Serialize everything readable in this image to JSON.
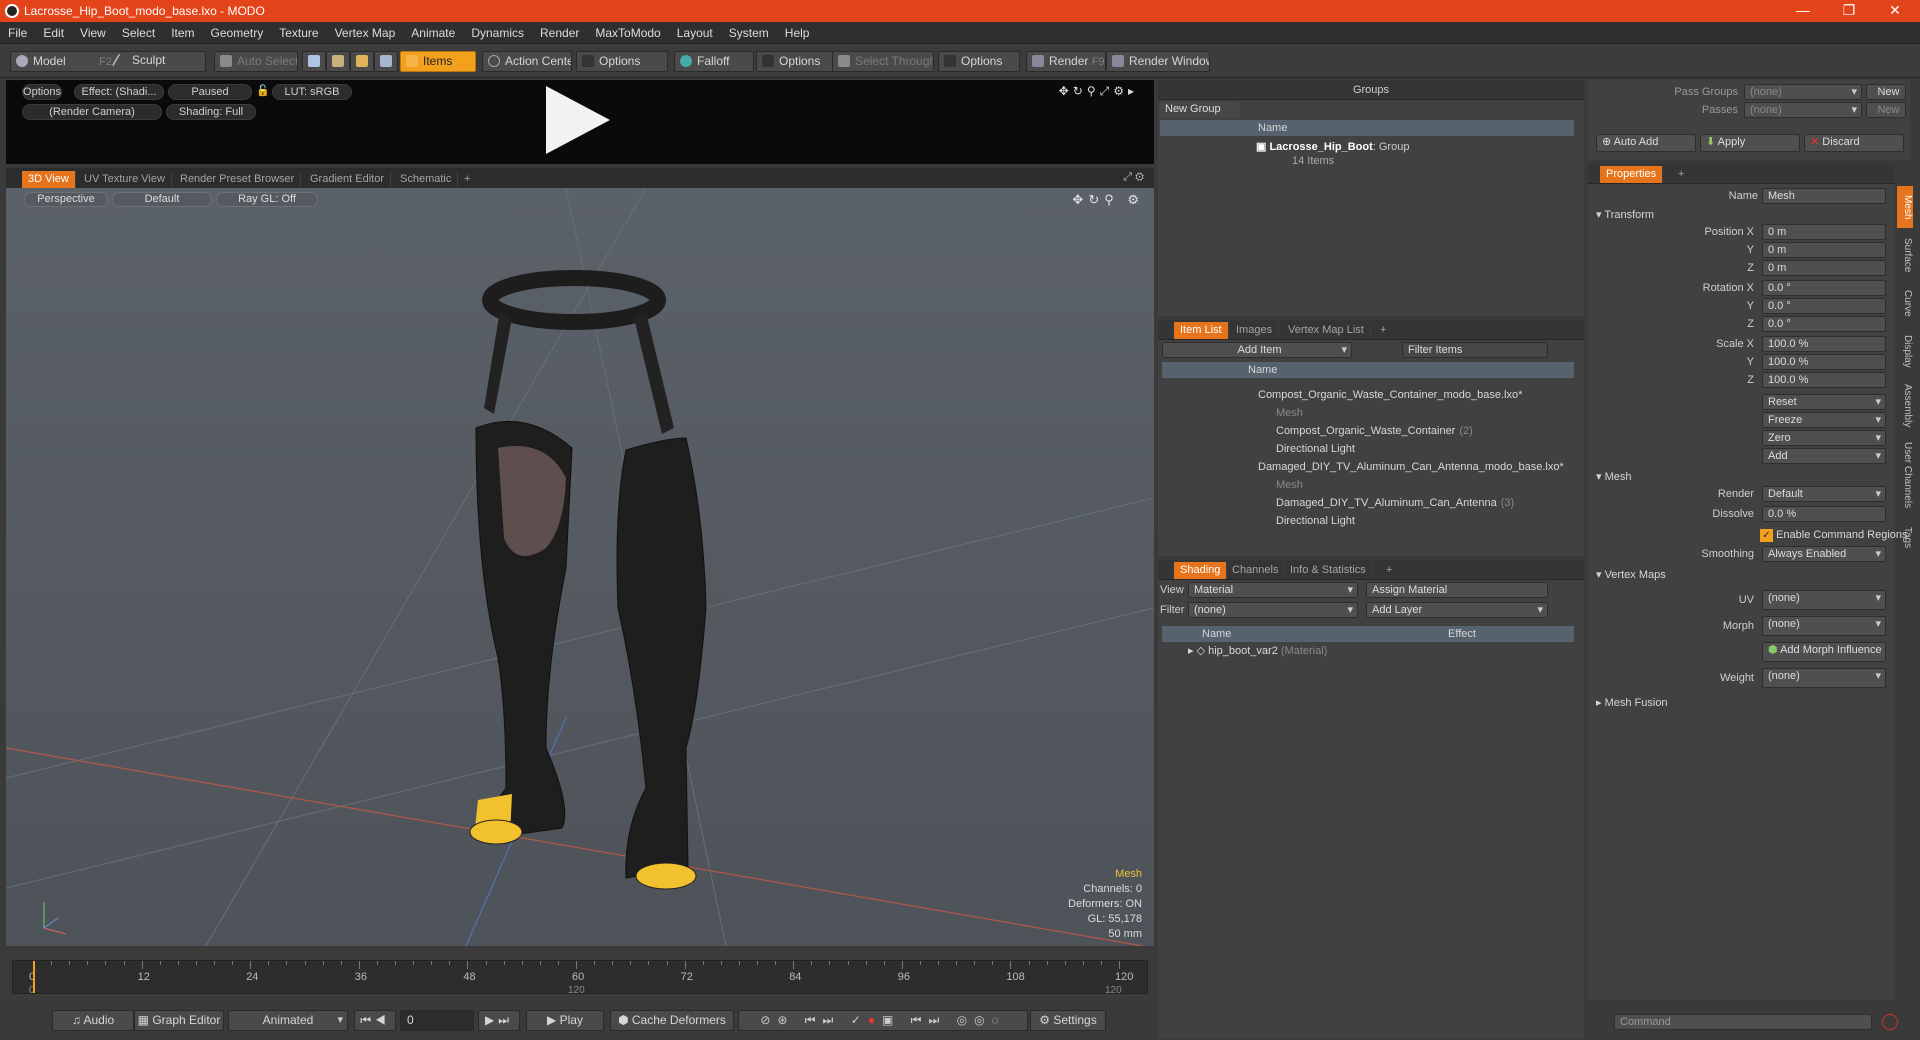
{
  "window": {
    "title": "Lacrosse_Hip_Boot_modo_base.lxo - MODO",
    "min": "—",
    "max": "❐",
    "close": "✕"
  },
  "menu": [
    "File",
    "Edit",
    "View",
    "Select",
    "Item",
    "Geometry",
    "Texture",
    "Vertex Map",
    "Animate",
    "Dynamics",
    "Render",
    "MaxToModo",
    "Layout",
    "System",
    "Help"
  ],
  "toolbar": {
    "model": "Model",
    "model_key": "F2",
    "sculpt": "Sculpt",
    "auto_select": "Auto Select",
    "items": "Items",
    "action_center": "Action Center",
    "options1": "Options",
    "falloff": "Falloff",
    "options2": "Options",
    "select_through": "Select Through",
    "options3": "Options",
    "render": "Render",
    "render_key": "F9",
    "render_window": "Render Window"
  },
  "preview": {
    "options": "Options",
    "effect": "Effect: (Shadi...",
    "paused": "Paused",
    "lut": "LUT: sRGB",
    "camera": "(Render Camera)",
    "shading": "Shading: Full"
  },
  "viewport_tabs": [
    "3D View",
    "UV Texture View",
    "Render Preset Browser",
    "Gradient Editor",
    "Schematic",
    "+"
  ],
  "viewport": {
    "perspective": "Perspective",
    "default": "Default",
    "raygl": "Ray GL: Off",
    "info_mesh": "Mesh",
    "info_channels": "Channels: 0",
    "info_deformers": "Deformers: ON",
    "info_gl": "GL: 55,178",
    "info_mm": "50 mm"
  },
  "timeline": {
    "top_labels": [
      "0",
      "12",
      "24",
      "36",
      "48",
      "60",
      "72",
      "84",
      "96",
      "108",
      "120"
    ],
    "bottom_left": "0",
    "bottom_mid": "120",
    "bottom_right": "120"
  },
  "transport": {
    "audio": "Audio",
    "graph_editor": "Graph Editor",
    "animated": "Animated",
    "frame": "0",
    "play": "Play",
    "cache_deformers": "Cache Deformers",
    "settings": "Settings"
  },
  "groups": {
    "title": "Groups",
    "new_group": "New Group",
    "col_name": "Name",
    "group_name": "Lacrosse_Hip_Boot",
    "group_type": ": Group",
    "group_count": "14 Items"
  },
  "itemlist": {
    "tabs": [
      "Item List",
      "Images",
      "Vertex Map List",
      "+"
    ],
    "add_item": "Add Item",
    "filter": "Filter Items",
    "col_name": "Name",
    "rows": [
      {
        "label": "Compost_Organic_Waste_Container_modo_base.lxo*",
        "extra": ""
      },
      {
        "label": "Mesh",
        "extra": ""
      },
      {
        "label": "Compost_Organic_Waste_Container",
        "extra": "(2)"
      },
      {
        "label": "Directional Light",
        "extra": ""
      },
      {
        "label": "Damaged_DIY_TV_Aluminum_Can_Antenna_modo_base.lxo*",
        "extra": ""
      },
      {
        "label": "Mesh",
        "extra": ""
      },
      {
        "label": "Damaged_DIY_TV_Aluminum_Can_Antenna",
        "extra": "(3)"
      },
      {
        "label": "Directional Light",
        "extra": ""
      }
    ]
  },
  "shading": {
    "tabs": [
      "Shading",
      "Channels",
      "Info & Statistics",
      "+"
    ],
    "view_label": "View",
    "view_value": "Material",
    "assign": "Assign Material",
    "filter_label": "Filter",
    "filter_value": "(none)",
    "add_layer": "Add Layer",
    "col_name": "Name",
    "col_effect": "Effect",
    "mat_name": "hip_boot_var2",
    "mat_type": "(Material)"
  },
  "passes": {
    "pass_groups": "Pass Groups",
    "pass_value": "(none)",
    "new": "New",
    "passes": "Passes",
    "passes_value": "(none)",
    "new2": "New"
  },
  "actions": {
    "auto_add": "Auto Add",
    "apply": "Apply",
    "discard": "Discard"
  },
  "properties": {
    "tab": "Properties",
    "plus": "+",
    "name_label": "Name",
    "name_value": "Mesh",
    "transform": "Transform",
    "pos_label": "Position X",
    "pos": [
      "0 m",
      "0 m",
      "0 m"
    ],
    "rot_label": "Rotation X",
    "rot": [
      "0.0 °",
      "0.0 °",
      "0.0 °"
    ],
    "scale_label": "Scale X",
    "scale": [
      "100.0 %",
      "100.0 %",
      "100.0 %"
    ],
    "y": "Y",
    "z": "Z",
    "reset": "Reset",
    "freeze": "Freeze",
    "zero": "Zero",
    "add": "Add",
    "mesh": "Mesh",
    "render_label": "Render",
    "render_value": "Default",
    "dissolve_label": "Dissolve",
    "dissolve_value": "0.0 %",
    "enable_cmd": "Enable Command Regions",
    "smoothing_label": "Smoothing",
    "smoothing_value": "Always Enabled",
    "vertex_maps": "Vertex Maps",
    "uv_label": "UV",
    "uv_value": "(none)",
    "morph_label": "Morph",
    "morph_value": "(none)",
    "add_morph": "Add Morph Influence",
    "weight_label": "Weight",
    "weight_value": "(none)",
    "mesh_fusion": "Mesh Fusion"
  },
  "side_tabs": [
    "Mesh",
    "Surface",
    "Curve",
    "Display",
    "Assembly",
    "User Channels",
    "Tags"
  ],
  "command": {
    "placeholder": "Command"
  },
  "colors": {
    "accent": "#e6741c",
    "title": "#e4441a",
    "items": "#f3a11d"
  }
}
